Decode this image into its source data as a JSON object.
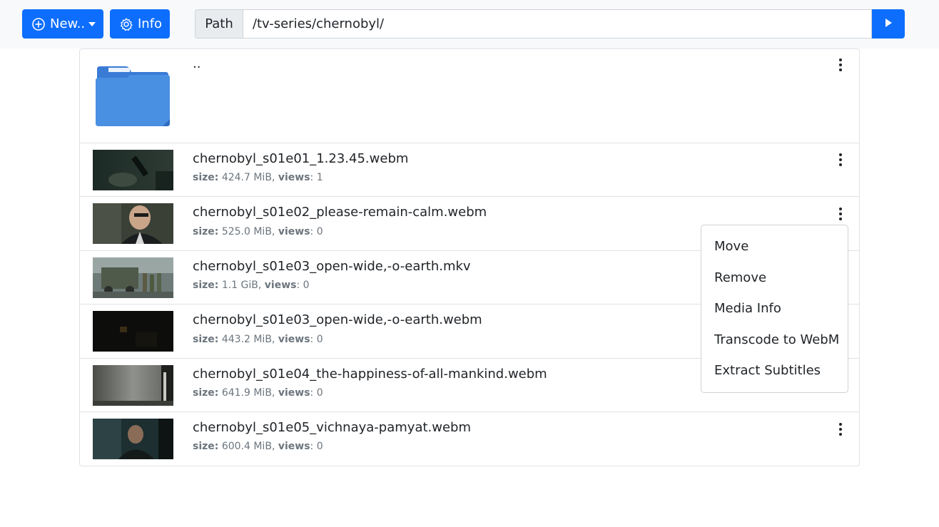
{
  "toolbar": {
    "new_label": "New..",
    "info_label": "Info",
    "path_label": "Path",
    "path_value": "/tv-series/chernobyl/",
    "icons": {
      "new": "plus-circle-icon",
      "info": "gear-icon",
      "go": "play-icon"
    },
    "accent_color": "#0d6efd"
  },
  "parent_dir": {
    "label": "..",
    "icon": "folder-icon",
    "folder_color": "#4a90e2"
  },
  "files": [
    {
      "name": "chernobyl_s01e01_1.23.45.webm",
      "size_label": "size:",
      "size": "424.7 MiB",
      "views_label": "views",
      "views": "1"
    },
    {
      "name": "chernobyl_s01e02_please-remain-calm.webm",
      "size_label": "size:",
      "size": "525.0 MiB",
      "views_label": "views",
      "views": "0"
    },
    {
      "name": "chernobyl_s01e03_open-wide,-o-earth.mkv",
      "size_label": "size:",
      "size": "1.1 GiB",
      "views_label": "views",
      "views": "0"
    },
    {
      "name": "chernobyl_s01e03_open-wide,-o-earth.webm",
      "size_label": "size:",
      "size": "443.2 MiB",
      "views_label": "views",
      "views": "0"
    },
    {
      "name": "chernobyl_s01e04_the-happiness-of-all-mankind.webm",
      "size_label": "size:",
      "size": "641.9 MiB",
      "views_label": "views",
      "views": "0"
    },
    {
      "name": "chernobyl_s01e05_vichnaya-pamyat.webm",
      "size_label": "size:",
      "size": "600.4 MiB",
      "views_label": "views",
      "views": "0"
    }
  ],
  "context_menu": {
    "items": [
      "Move",
      "Remove",
      "Media Info",
      "Transcode to WebM",
      "Extract Subtitles"
    ]
  }
}
